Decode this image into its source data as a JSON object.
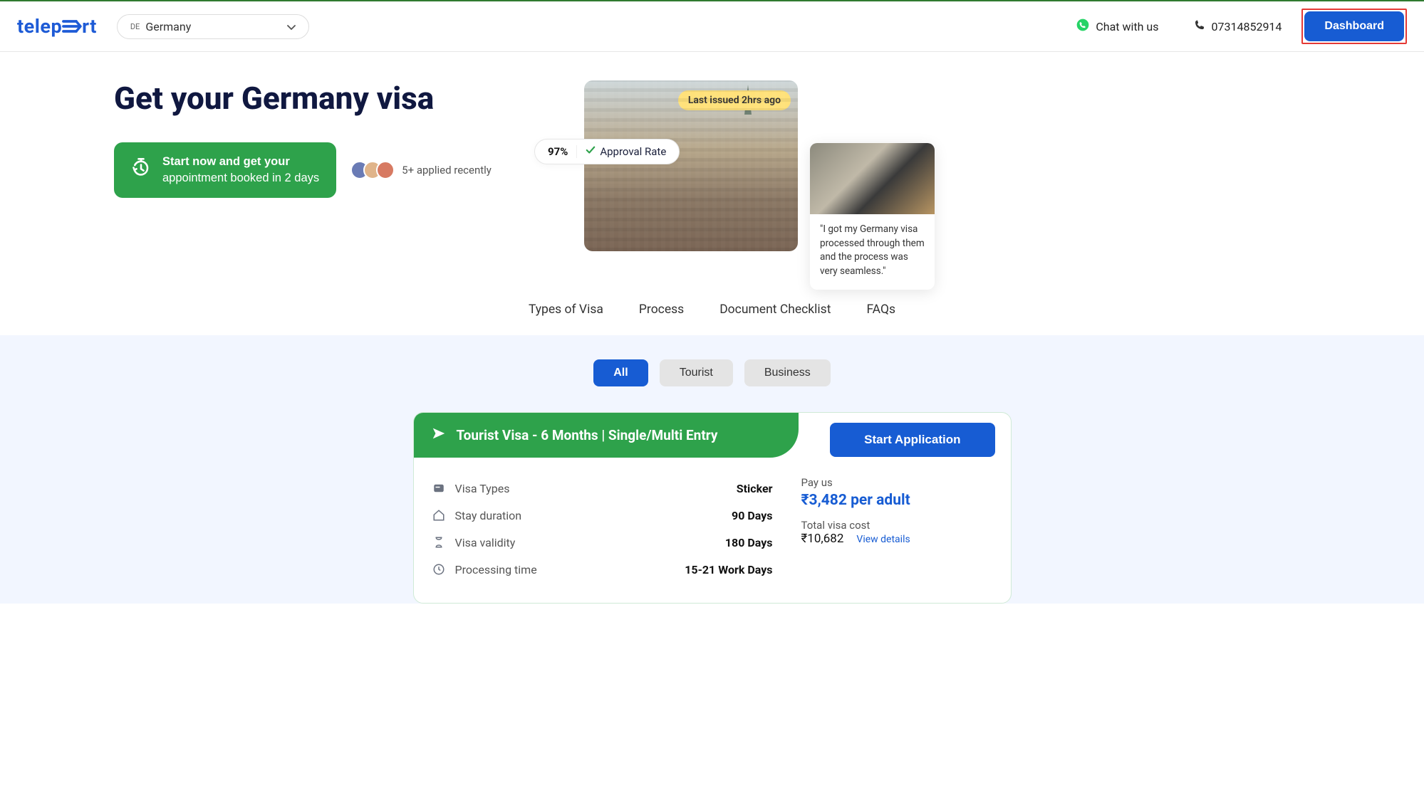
{
  "header": {
    "logo": "teleport",
    "country_code": "DE",
    "country_name": "Germany",
    "chat_label": "Chat with us",
    "phone_number": "07314852914",
    "dashboard_label": "Dashboard"
  },
  "hero": {
    "title": "Get your Germany visa",
    "cta_line1": "Start now and get your",
    "cta_line2": "appointment booked in 2 days",
    "applied_recently": "5+ applied recently",
    "approval_pct": "97%",
    "approval_label": "Approval Rate",
    "issued_badge": "Last issued 2hrs ago",
    "testimonial": "\"I got my Germany visa processed through them and the process was very seamless.\""
  },
  "nav": {
    "items": [
      "Types of Visa",
      "Process",
      "Document Checklist",
      "FAQs"
    ]
  },
  "filters": {
    "items": [
      "All",
      "Tourist",
      "Business"
    ],
    "active_index": 0
  },
  "visa_card": {
    "title": "Tourist Visa - 6 Months | Single/Multi Entry",
    "start_app": "Start Application",
    "rows": [
      {
        "label": "Visa Types",
        "value": "Sticker"
      },
      {
        "label": "Stay duration",
        "value": "90 Days"
      },
      {
        "label": "Visa validity",
        "value": "180 Days"
      },
      {
        "label": "Processing time",
        "value": "15-21 Work Days"
      }
    ],
    "pay_us_label": "Pay us",
    "price": "₹3,482 per adult",
    "total_label": "Total visa cost",
    "total_value": "₹10,682",
    "view_details": "View details"
  }
}
